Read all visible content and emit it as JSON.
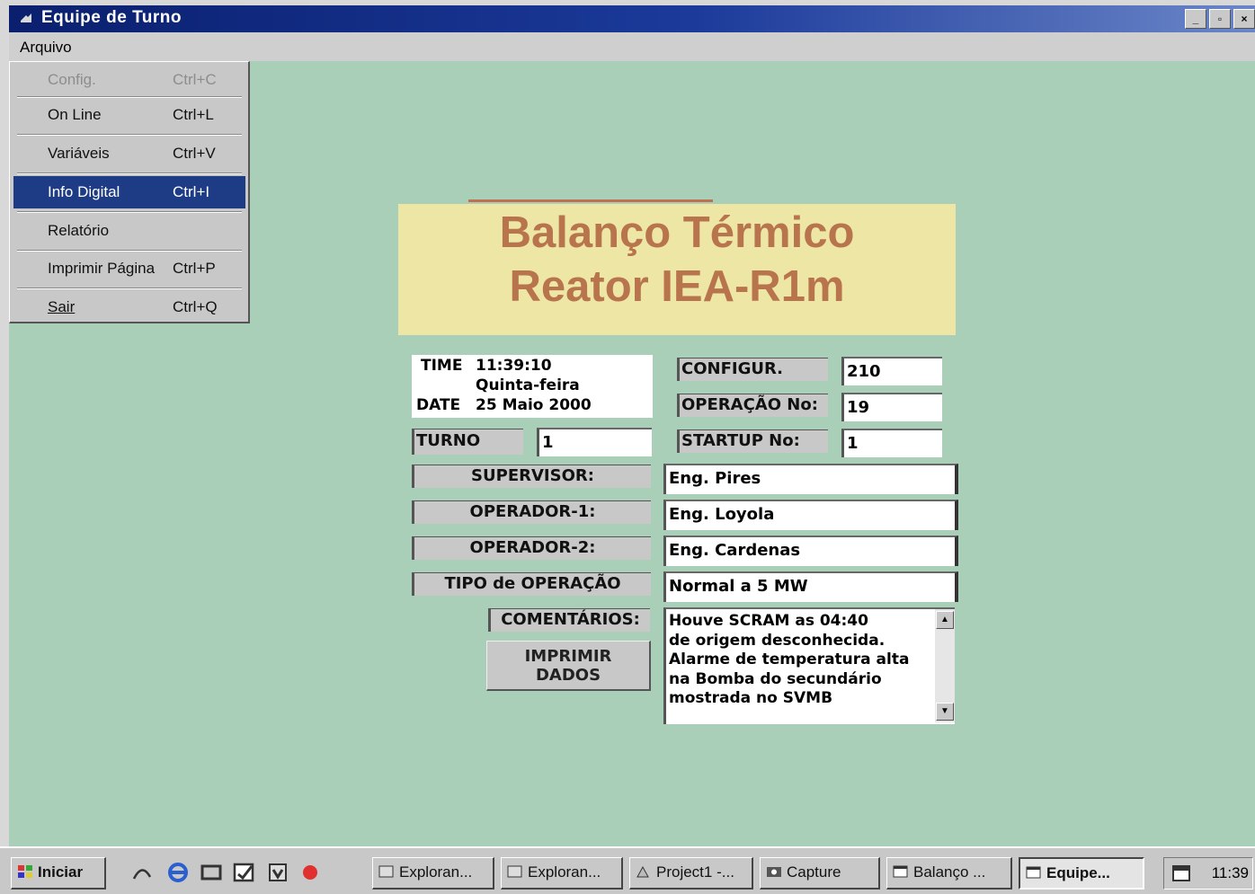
{
  "window": {
    "title": "Equipe de Turno",
    "buttons": [
      "minimize-icon",
      "maximize-icon",
      "close-icon"
    ]
  },
  "menubar": {
    "arquivo": "Arquivo"
  },
  "file_menu": {
    "items": [
      {
        "label": "Config.",
        "shortcut": "Ctrl+C",
        "enabled": false
      },
      {
        "label": "On Line",
        "shortcut": "Ctrl+L",
        "enabled": true
      },
      {
        "label": "Variáveis",
        "shortcut": "Ctrl+V",
        "enabled": true
      },
      {
        "label": "Info Digital",
        "shortcut": "Ctrl+I",
        "enabled": true,
        "selected": true
      },
      {
        "label": "Relatório",
        "shortcut": "",
        "enabled": true
      },
      {
        "label": "Imprimir Página",
        "shortcut": "Ctrl+P",
        "enabled": true
      },
      {
        "label": "Sair",
        "shortcut": "Ctrl+Q",
        "enabled": true
      }
    ]
  },
  "banner": {
    "line1": "Balanço Térmico",
    "line2": "Reator IEA-R1m"
  },
  "datetime": {
    "time_label": "TIME",
    "time": "11:39:10",
    "weekday": "Quinta-feira",
    "date_label": "DATE",
    "date": "25 Maio 2000"
  },
  "fields": {
    "turno_label": "TURNO",
    "turno": "1",
    "config_label": "CONFIGUR.",
    "config": "210",
    "operacao_label": "OPERAÇÃO No:",
    "operacao": "19",
    "startup_label": "STARTUP No:",
    "startup": "1",
    "supervisor_label": "SUPERVISOR:",
    "supervisor": "Eng. Pires",
    "operador1_label": "OPERADOR-1:",
    "operador1": "Eng. Loyola",
    "operador2_label": "OPERADOR-2:",
    "operador2": "Eng. Cardenas",
    "tipo_label": "TIPO de OPERAÇÃO",
    "tipo": "Normal a 5 MW",
    "comentarios_label": "COMENTÁRIOS:",
    "comentarios": "Houve SCRAM as 04:40\nde origem desconhecida.\nAlarme de temperatura alta\nna Bomba do secundário\nmostrada no SVMB"
  },
  "print_button": {
    "line1": "IMPRIMIR",
    "line2": "DADOS"
  },
  "taskbar": {
    "start": "Iniciar",
    "tasks": [
      {
        "label": "Exploran...",
        "icon": "explorer-icon"
      },
      {
        "label": "Exploran...",
        "icon": "explorer-icon"
      },
      {
        "label": "Project1 -...",
        "icon": "project-icon"
      },
      {
        "label": "Capture",
        "icon": "capture-icon"
      },
      {
        "label": "Balanço ...",
        "icon": "window-icon"
      },
      {
        "label": "Equipe...",
        "icon": "window-icon",
        "active": true
      }
    ],
    "clock": "11:39"
  },
  "colors": {
    "client_bg": "#a9cfb8",
    "banner_bg": "#ede6a4",
    "banner_text": "#b8744d",
    "menu_highlight": "#1e3c86",
    "titlebar": "#0a1f6e"
  }
}
